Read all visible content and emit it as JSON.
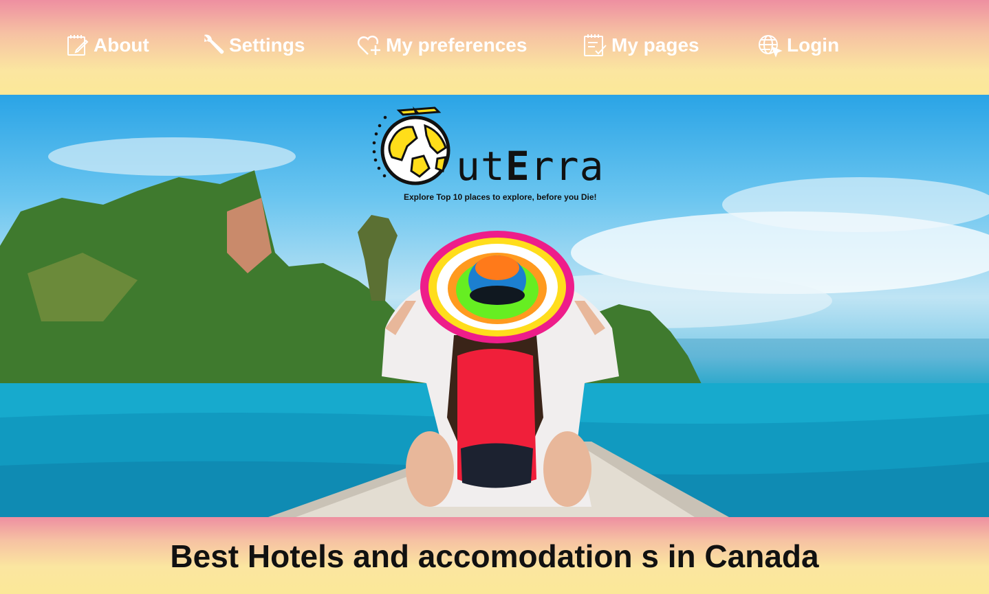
{
  "nav": {
    "about": {
      "label": "About",
      "icon": "edit-note-icon"
    },
    "settings": {
      "label": "Settings",
      "icon": "wrench-icon"
    },
    "preferences": {
      "label": "My preferences",
      "icon": "heart-plus-icon"
    },
    "pages": {
      "label": "My pages",
      "icon": "checklist-icon"
    },
    "login": {
      "label": "Login",
      "icon": "globe-cursor-icon"
    }
  },
  "logo": {
    "word_prefix": "ut",
    "word_big": "E",
    "word_suffix": "rra",
    "tagline": "Explore Top 10 places to explore, before you Die!"
  },
  "headline": "Best Hotels and accomodation s in Canada",
  "colors": {
    "band_top": "#ee8fa1",
    "band_bottom": "#fbe898",
    "nav_text": "#ffffff",
    "headline_text": "#111111"
  }
}
